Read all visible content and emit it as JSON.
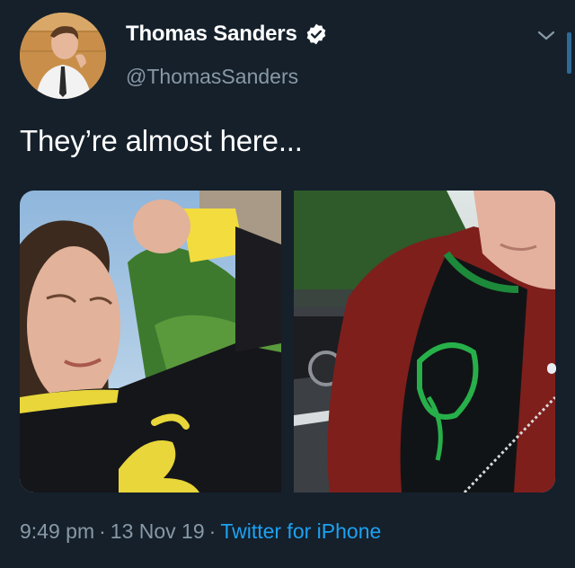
{
  "user": {
    "display_name": "Thomas Sanders",
    "handle": "@ThomasSanders",
    "verified": true
  },
  "tweet": {
    "text": "They’re almost here...",
    "media_count": 2
  },
  "meta": {
    "time": "9:49 pm",
    "separator": "·",
    "date": "13 Nov 19",
    "source": "Twitter for iPhone"
  },
  "icons": {
    "verified": "verified-badge-icon",
    "more": "chevron-down-icon"
  },
  "colors": {
    "background": "#15202b",
    "secondary_text": "#8899a6",
    "link": "#1da1f2"
  }
}
